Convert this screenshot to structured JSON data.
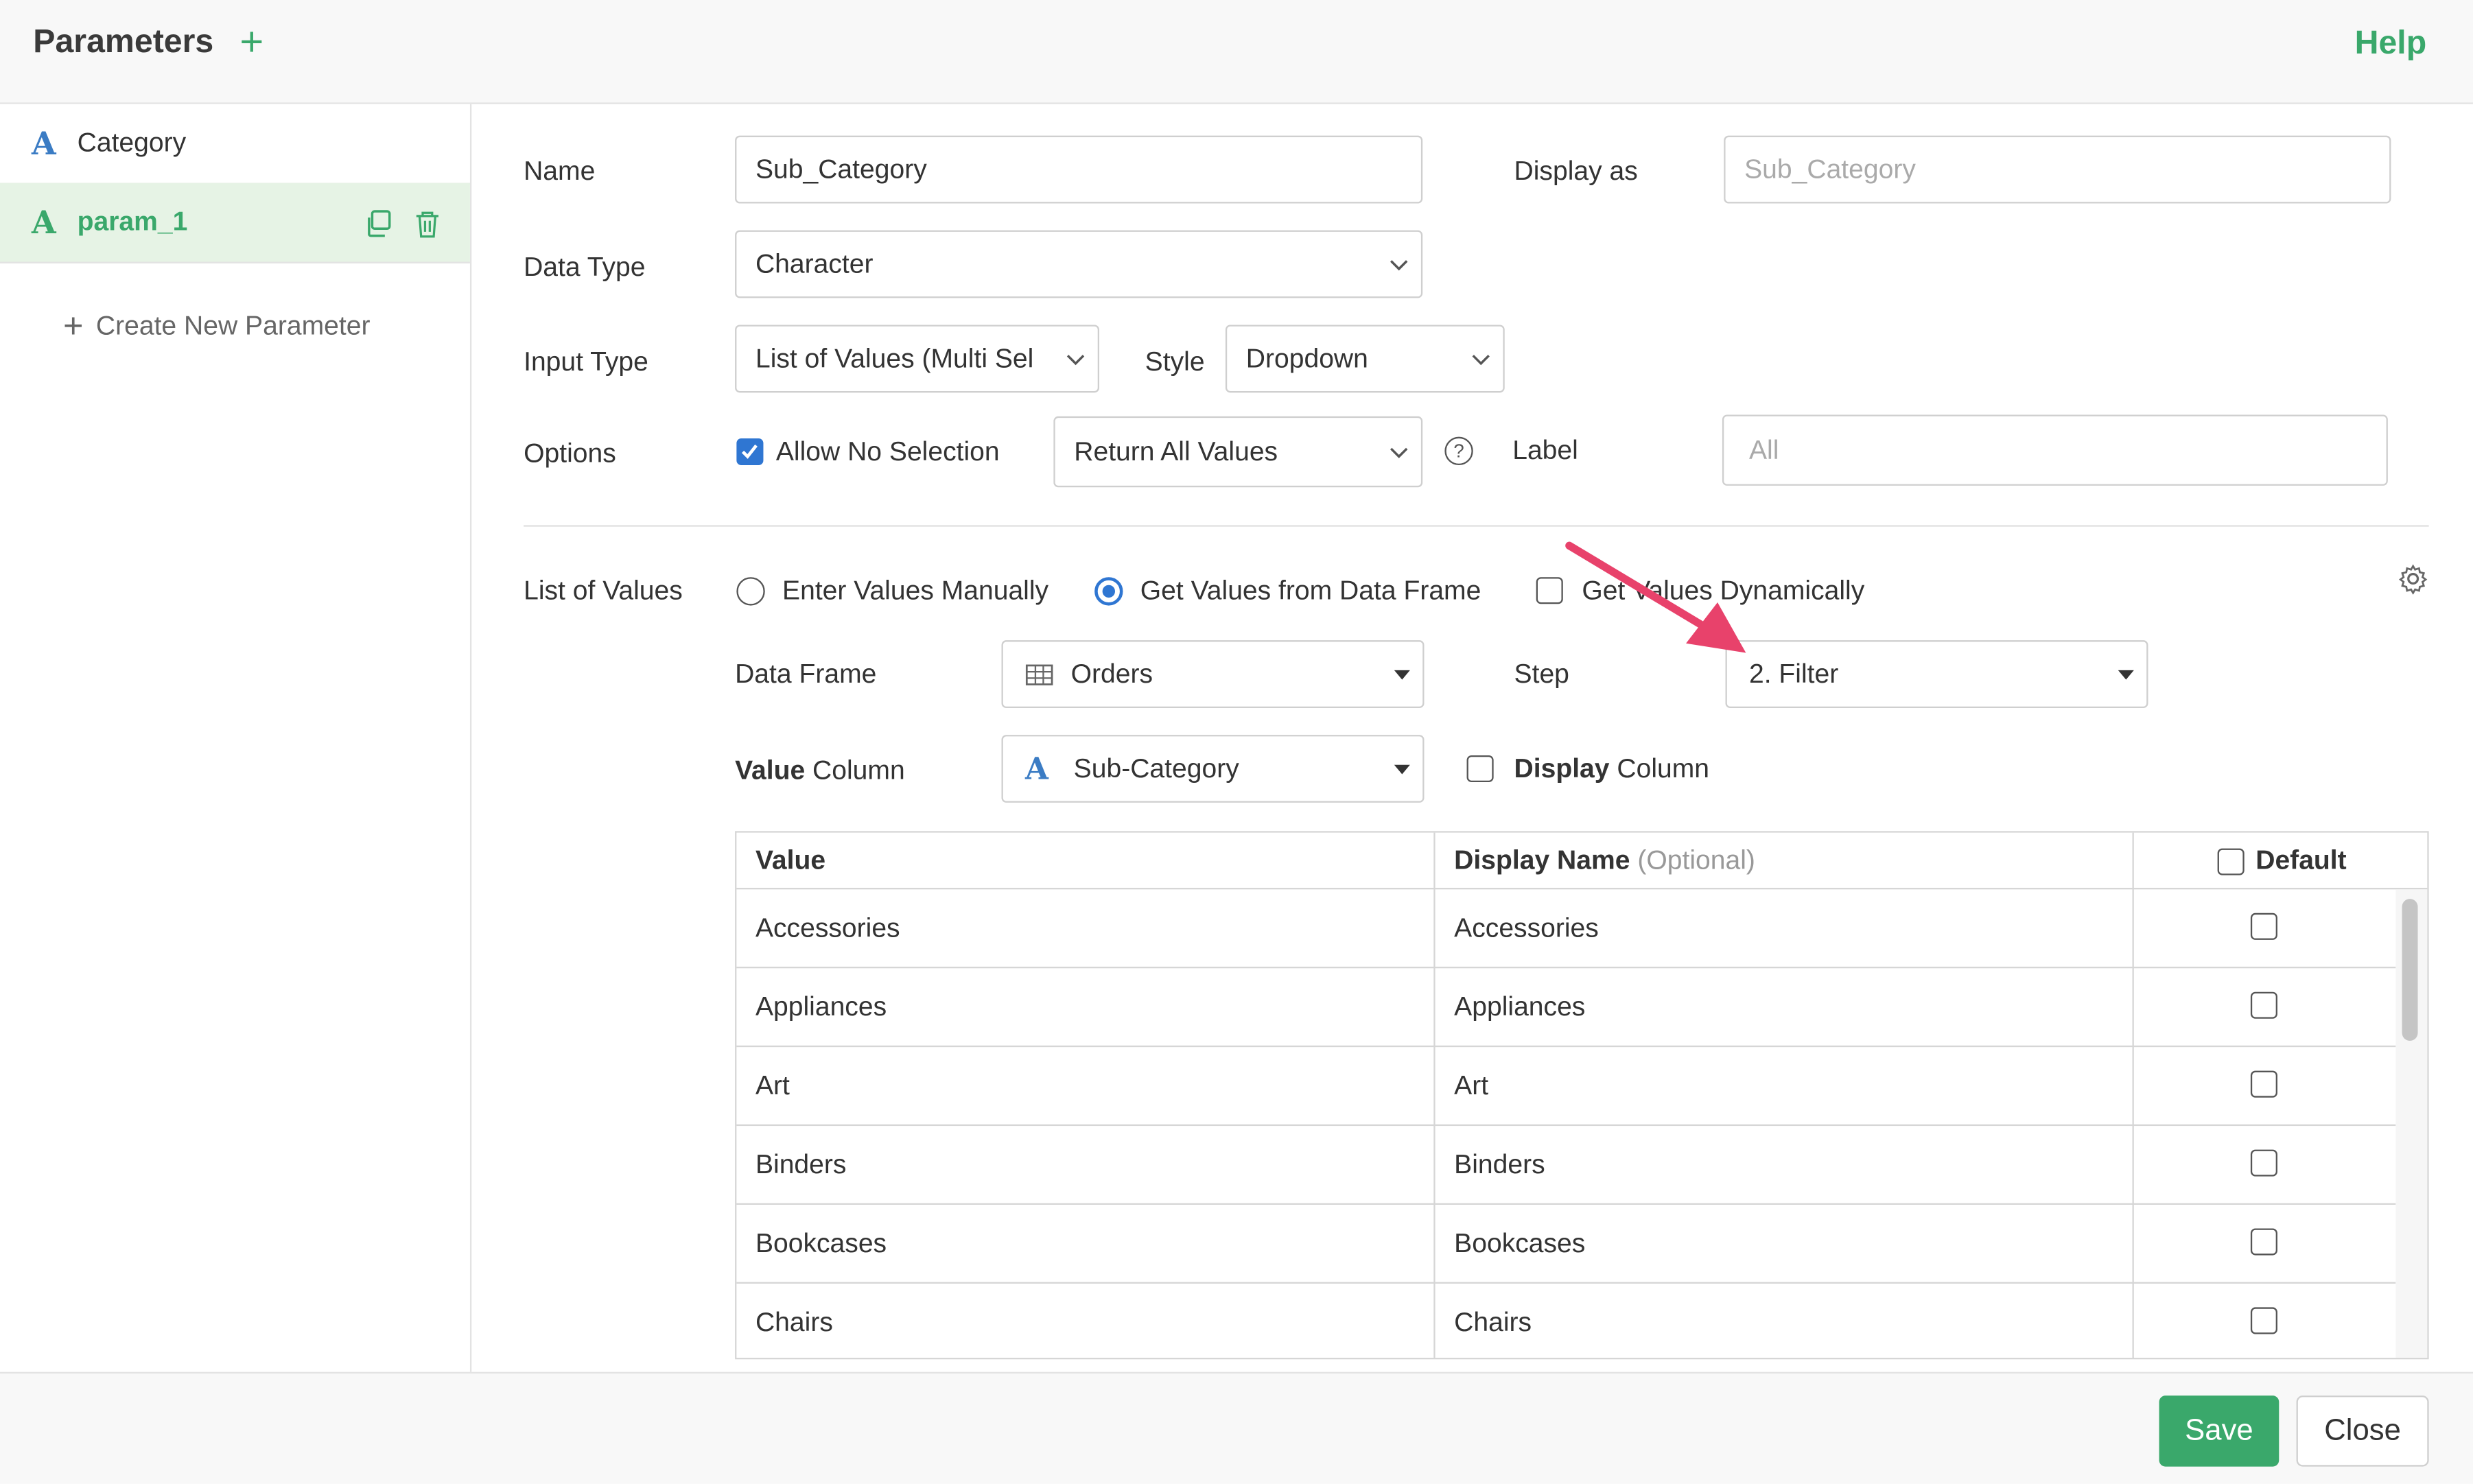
{
  "header": {
    "title": "Parameters",
    "add_icon": "plus-icon",
    "help": "Help"
  },
  "sidebar": {
    "items": [
      {
        "icon": "A",
        "label": "Category"
      },
      {
        "icon": "A",
        "label": "param_1"
      }
    ],
    "create_new": "Create New Parameter"
  },
  "form": {
    "name_label": "Name",
    "name_value": "Sub_Category",
    "display_as_label": "Display as",
    "display_as_placeholder": "Sub_Category",
    "data_type_label": "Data Type",
    "data_type_value": "Character",
    "input_type_label": "Input Type",
    "input_type_value": "List of Values (Multi Sel",
    "style_label": "Style",
    "style_value": "Dropdown",
    "options_label": "Options",
    "allow_no_selection": "Allow No Selection",
    "allow_no_selection_checked": true,
    "return_select_value": "Return All Values",
    "help_icon": "?",
    "label_label": "Label",
    "label_placeholder": "All"
  },
  "lov": {
    "label": "List of Values",
    "radio_manual": "Enter Values Manually",
    "radio_dataframe": "Get Values from Data Frame",
    "selected_source": "Get Values from Data Frame",
    "dynamic": "Get Values Dynamically",
    "data_frame_label": "Data Frame",
    "data_frame_value": "Orders",
    "step_label": "Step",
    "step_value": "2. Filter",
    "value_column_bold": "Value",
    "value_column_rest": " Column",
    "value_column_value": "Sub-Category",
    "display_column_bold": "Display",
    "display_column_rest": " Column"
  },
  "table": {
    "headers": {
      "value": "Value",
      "display_name": "Display Name",
      "optional": "(Optional)",
      "default": "Default"
    },
    "rows": [
      {
        "value": "Accessories",
        "display": "Accessories"
      },
      {
        "value": "Appliances",
        "display": "Appliances"
      },
      {
        "value": "Art",
        "display": "Art"
      },
      {
        "value": "Binders",
        "display": "Binders"
      },
      {
        "value": "Bookcases",
        "display": "Bookcases"
      },
      {
        "value": "Chairs",
        "display": "Chairs"
      }
    ]
  },
  "footer": {
    "save": "Save",
    "close": "Close"
  },
  "colors": {
    "accent_green": "#3aa86b",
    "checkbox_blue": "#2f76d2",
    "annotation_arrow": "#e8426b"
  }
}
